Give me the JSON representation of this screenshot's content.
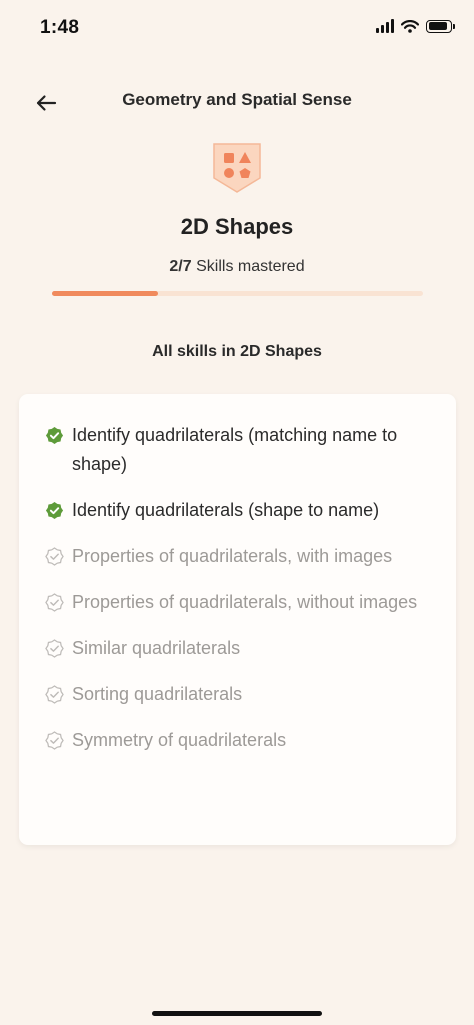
{
  "status": {
    "time": "1:48"
  },
  "header": {
    "title": "Geometry and Spatial Sense"
  },
  "unit": {
    "title": "2D Shapes",
    "mastered_count": "2/7",
    "mastered_label": "Skills mastered",
    "progress": 0.286
  },
  "section": {
    "heading": "All skills in 2D Shapes"
  },
  "skills": [
    {
      "label": "Identify quadrilaterals (matching name to shape)",
      "status": "mastered"
    },
    {
      "label": "Identify quadrilaterals (shape to name)",
      "status": "mastered"
    },
    {
      "label": "Properties of quadrilaterals, with images",
      "status": "not-mastered"
    },
    {
      "label": "Properties of quadrilaterals, without images",
      "status": "not-mastered"
    },
    {
      "label": "Similar quadrilaterals",
      "status": "not-mastered"
    },
    {
      "label": "Sorting quadrilaterals",
      "status": "not-mastered"
    },
    {
      "label": "Symmetry of quadrilaterals",
      "status": "not-mastered"
    }
  ],
  "colors": {
    "accent": "#F08A5D",
    "mastered": "#5E9B3A",
    "muted": "#BEBBB8",
    "background": "#FAF3EC"
  },
  "icons": {
    "back": "arrow-left-icon",
    "badge": "shapes-badge-icon",
    "mastered": "check-badge-icon",
    "not_mastered": "check-badge-outline-icon"
  }
}
